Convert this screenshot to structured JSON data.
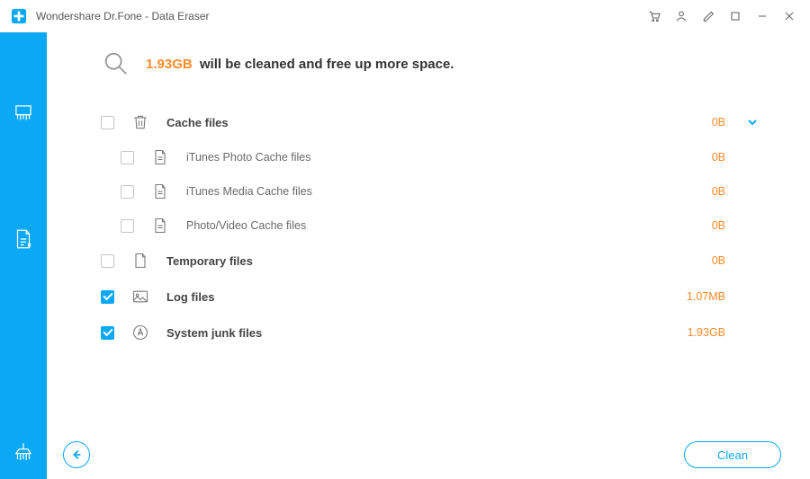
{
  "window": {
    "title": "Wondershare Dr.Fone - Data Eraser"
  },
  "summary": {
    "size": "1.93GB",
    "text": "will be cleaned and free up more space."
  },
  "categories": [
    {
      "key": "cache",
      "label": "Cache files",
      "size": "0B",
      "checked": false,
      "expanded": true,
      "children": [
        {
          "label": "iTunes Photo Cache files",
          "size": "0B",
          "checked": false
        },
        {
          "label": "iTunes Media Cache files",
          "size": "0B",
          "checked": false
        },
        {
          "label": "Photo/Video Cache files",
          "size": "0B",
          "checked": false
        }
      ]
    },
    {
      "key": "temp",
      "label": "Temporary files",
      "size": "0B",
      "checked": false
    },
    {
      "key": "log",
      "label": "Log files",
      "size": "1.07MB",
      "checked": true
    },
    {
      "key": "sysjunk",
      "label": "System junk files",
      "size": "1.93GB",
      "checked": true
    }
  ],
  "buttons": {
    "clean": "Clean"
  }
}
